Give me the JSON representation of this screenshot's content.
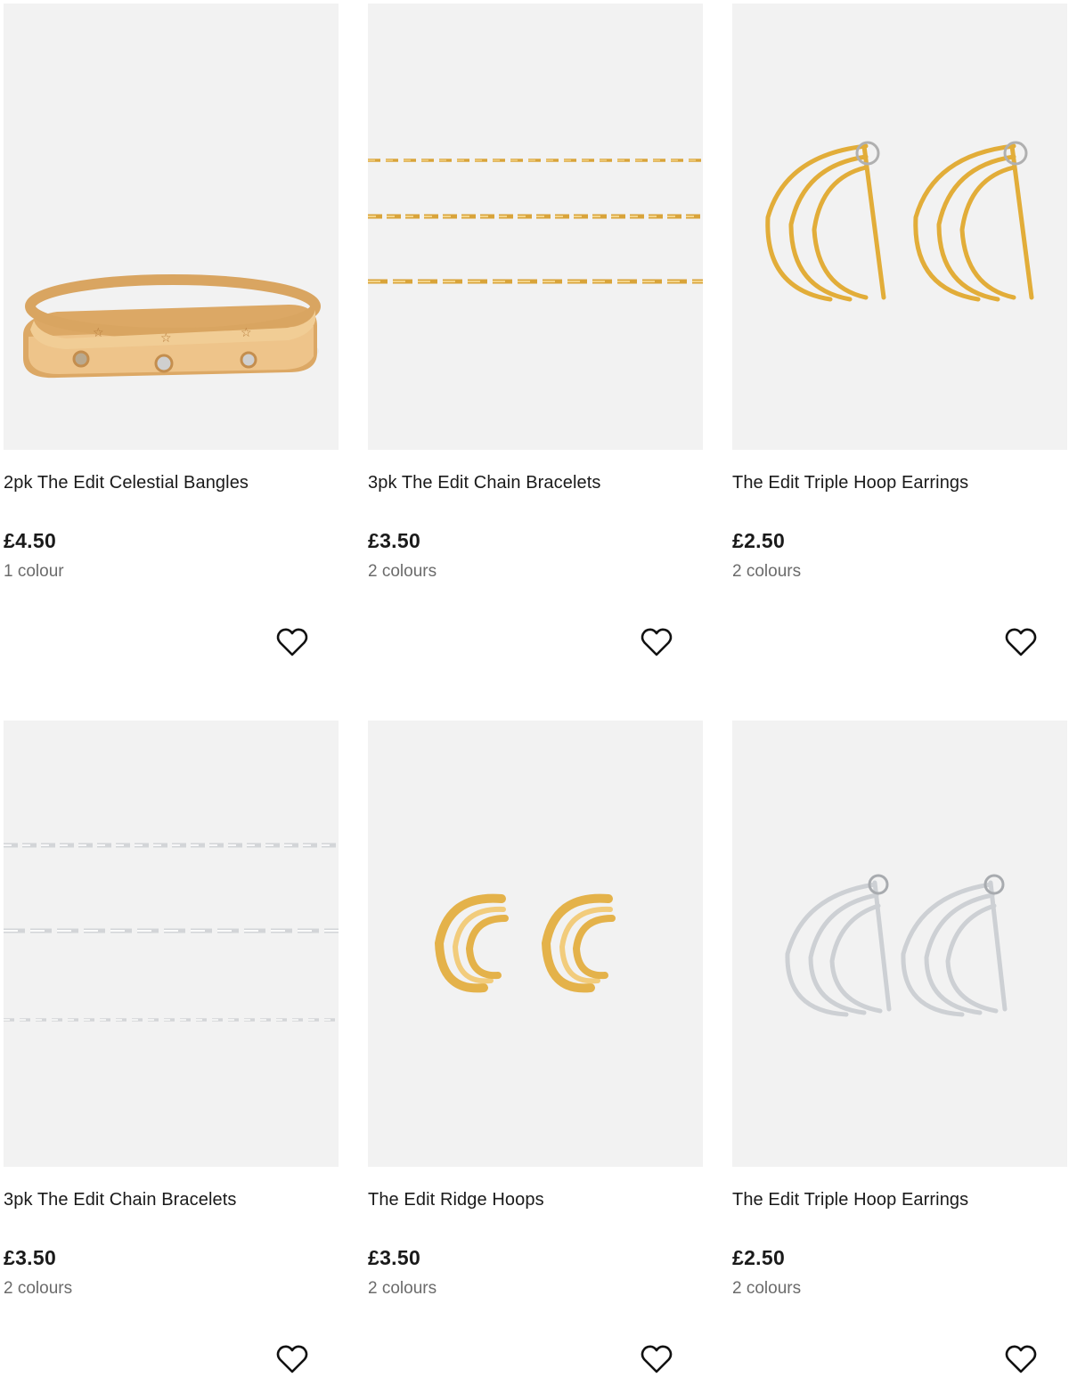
{
  "products": [
    {
      "title": "2pk The Edit Celestial Bangles",
      "price": "£4.50",
      "colours": "1 colour",
      "image_icon": "gold-bangles-image",
      "metal": "#e3b86a"
    },
    {
      "title": "3pk The Edit Chain Bracelets",
      "price": "£3.50",
      "colours": "2 colours",
      "image_icon": "gold-chain-bracelets-image",
      "metal": "#e6b94a"
    },
    {
      "title": "The Edit Triple Hoop Earrings",
      "price": "£2.50",
      "colours": "2 colours",
      "image_icon": "gold-triple-hoop-earrings-image",
      "metal": "#e9b83e"
    },
    {
      "title": "3pk The Edit Chain Bracelets",
      "price": "£3.50",
      "colours": "2 colours",
      "image_icon": "silver-chain-bracelets-image",
      "metal": "#d6d8db"
    },
    {
      "title": "The Edit Ridge Hoops",
      "price": "£3.50",
      "colours": "2 colours",
      "image_icon": "gold-ridge-hoops-image",
      "metal": "#e8b64e"
    },
    {
      "title": "The Edit Triple Hoop Earrings",
      "price": "£2.50",
      "colours": "2 colours",
      "image_icon": "silver-triple-hoop-earrings-image",
      "metal": "#cfd2d6"
    }
  ],
  "wishlist_icon": "heart-outline-icon"
}
